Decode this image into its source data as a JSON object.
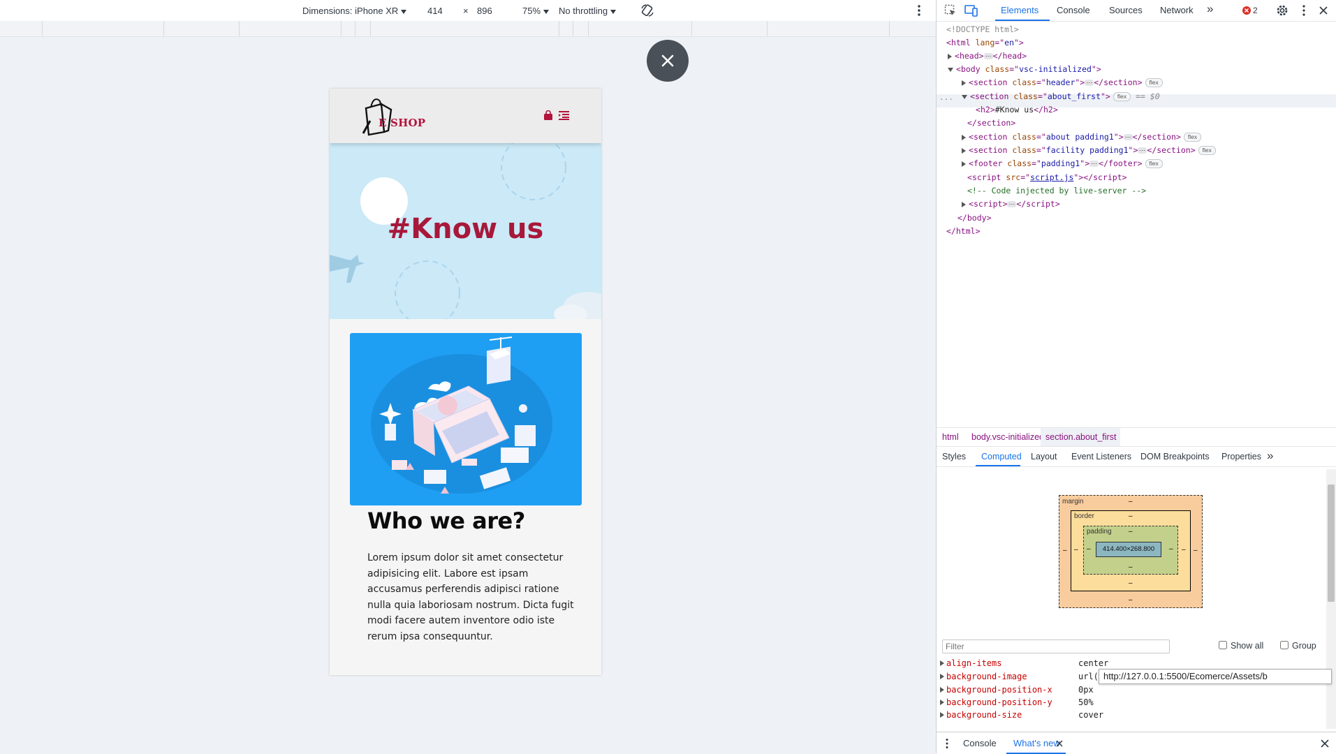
{
  "device_toolbar": {
    "dimensions_label": "Dimensions: iPhone XR",
    "width": "414",
    "times": "×",
    "height": "896",
    "zoom": "75%",
    "throttling": "No throttling"
  },
  "page": {
    "logo_text": "E SHOP",
    "hero_title": "#Know us",
    "section_heading": "Who we are?",
    "paragraph": "Lorem ipsum dolor sit amet consectetur adipisicing elit. Labore est ipsam accusamus perferendis adipisci ratione nulla quia laboriosam nostrum. Dicta fugit modi facere autem inventore odio iste rerum ipsa consequuntur.",
    "brand_color": "#b3133c",
    "hero_bg": "#cbe9f7",
    "illustration_bg": "#1f9ff3"
  },
  "devtools": {
    "tabs": [
      "Elements",
      "Console",
      "Sources",
      "Network"
    ],
    "active_tab": "Elements",
    "more_tabs": "»",
    "error_count": "2",
    "dom": {
      "doctype": "<!DOCTYPE html>",
      "html_open_tag": "html",
      "html_lang_attr": "lang",
      "html_lang_val": "en",
      "head": "head",
      "body_tag": "body",
      "body_class": "vsc-initialized",
      "section_tag": "section",
      "class_attr": "class",
      "header_class": "header",
      "about_first_class": "about_first",
      "h2_text": "#Know us",
      "about_class": "about padding1",
      "facility_class": "facility padding1",
      "footer_tag": "footer",
      "footer_class": "padding1",
      "script_tag": "script",
      "src_attr": "src",
      "script_src": "script.js",
      "comment": "<!-- Code injected by live-server -->",
      "selected_marker": "== $0",
      "flex_badge": "flex",
      "h2_tag": "h2"
    },
    "breadcrumbs": [
      "html",
      "body.vsc-initialized",
      "section.about_first"
    ],
    "sub_tabs": [
      "Styles",
      "Computed",
      "Layout",
      "Event Listeners",
      "DOM Breakpoints",
      "Properties"
    ],
    "active_sub_tab": "Computed",
    "box_model": {
      "margin_label": "margin",
      "border_label": "border",
      "padding_label": "padding",
      "dash": "–",
      "content_size": "414.400×268.800"
    },
    "filter_placeholder": "Filter",
    "show_all_label": "Show all",
    "group_label": "Group",
    "computed_props": [
      {
        "name": "align-items",
        "value": "center"
      },
      {
        "name": "background-image",
        "value": "url("
      },
      {
        "name": "background-position-x",
        "value": "0px"
      },
      {
        "name": "background-position-y",
        "value": "50%"
      },
      {
        "name": "background-size",
        "value": "cover"
      }
    ],
    "url_tooltip": "http://127.0.0.1:5500/Ecomerce/Assets/b",
    "drawer_tabs": [
      "Console",
      "What's new"
    ]
  }
}
